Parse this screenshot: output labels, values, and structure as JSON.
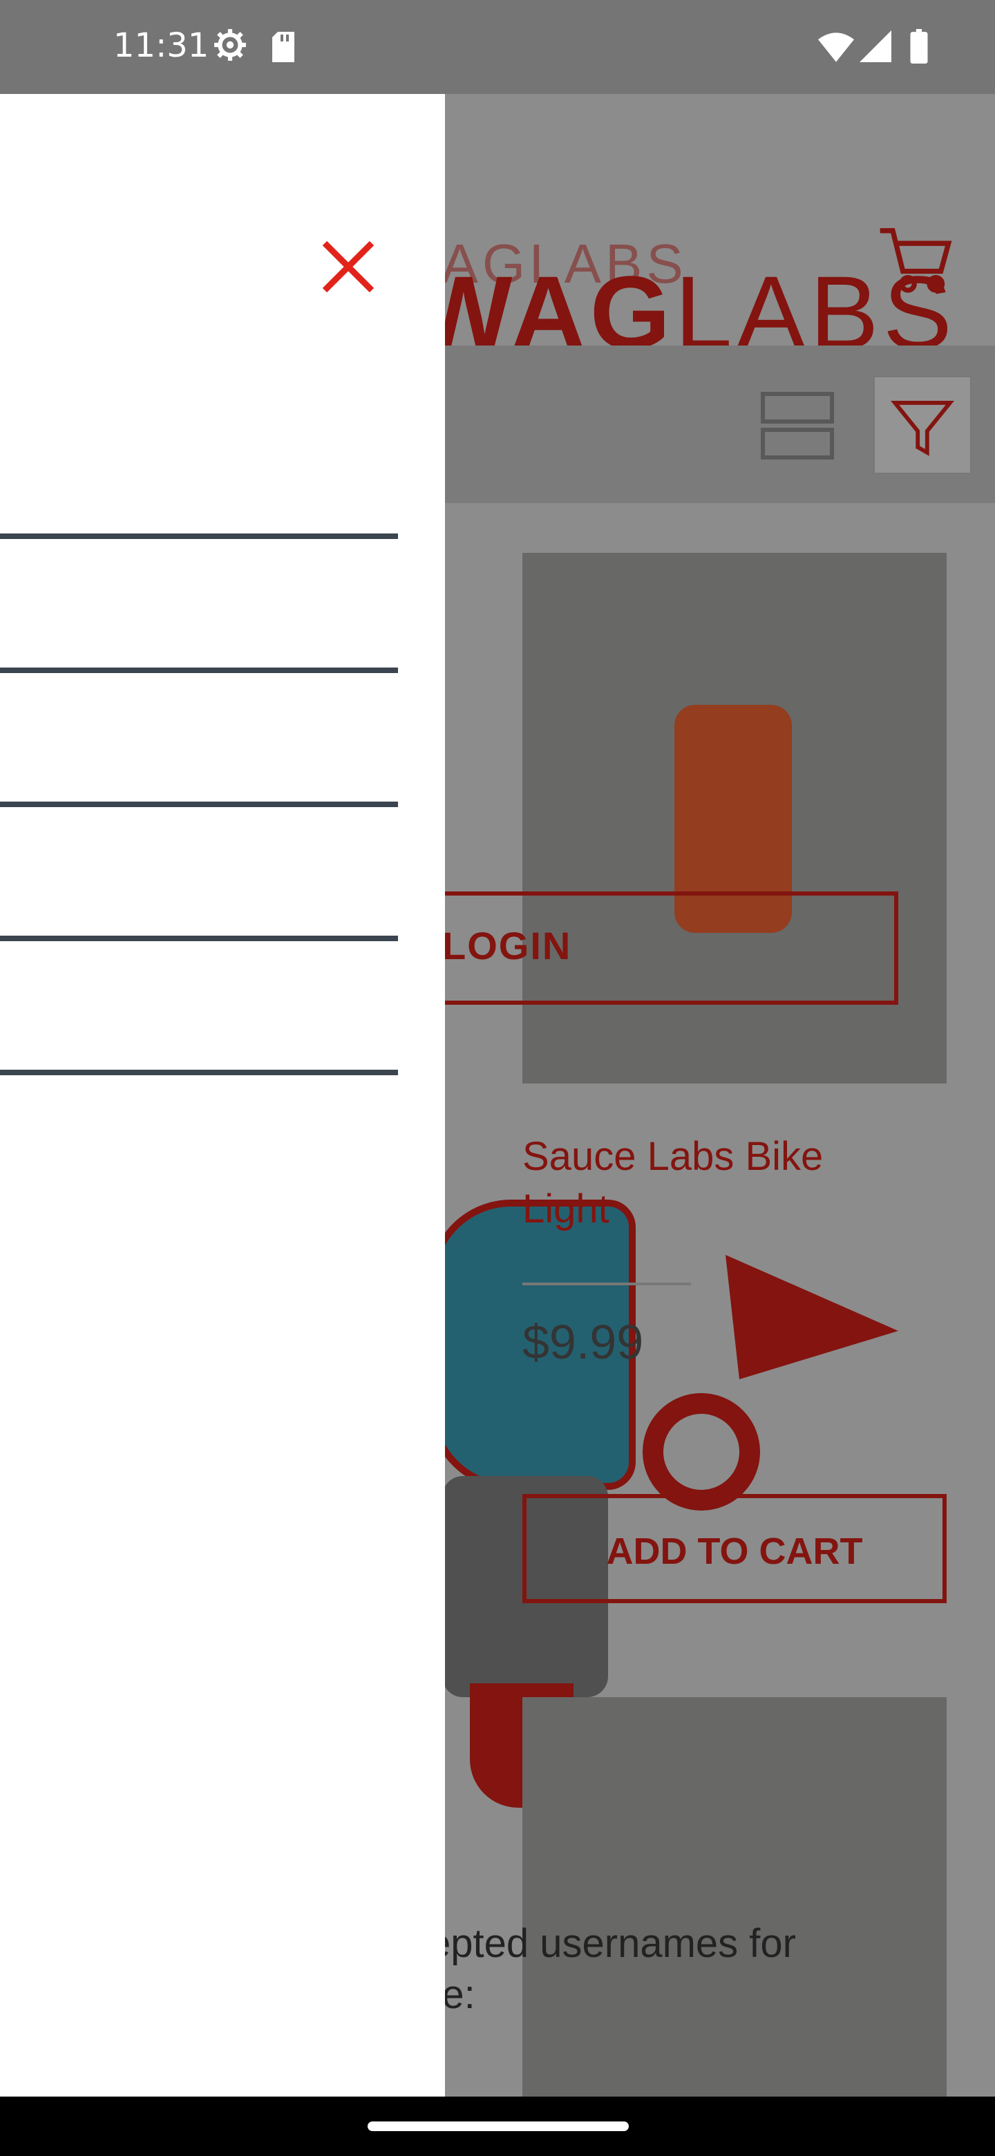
{
  "status_bar": {
    "time": "11:31",
    "icons": [
      "gear-icon",
      "sd-card-icon",
      "wifi-icon",
      "cellular-icon",
      "battery-icon"
    ]
  },
  "app": {
    "logo_small": "WAGLABS",
    "logo_big_bold": "WAG",
    "logo_big_light": "LABS",
    "login_button": "LOGIN",
    "product": {
      "title": "Sauce Labs Bike Light",
      "price": "$9.99",
      "add_to_cart": "ADD TO CART"
    },
    "accepted_text_line1": "epted usernames for",
    "accepted_text_line2": "re:"
  },
  "drawer": {
    "close_icon": "close-icon",
    "items": [
      {
        "label": ""
      },
      {
        "label": ""
      },
      {
        "label": ""
      },
      {
        "label": ""
      },
      {
        "label": ""
      }
    ]
  },
  "colors": {
    "brand_red": "#e2231a",
    "drawer_bg": "#ffffff",
    "divider": "#3b4550",
    "status_bar": "#757575"
  }
}
